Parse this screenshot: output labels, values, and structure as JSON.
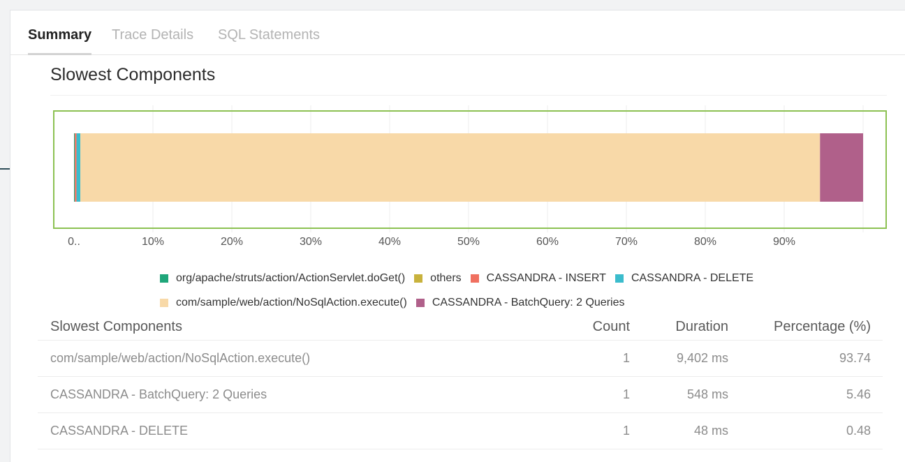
{
  "tabs": [
    {
      "label": "Summary",
      "active": true
    },
    {
      "label": "Trace Details",
      "active": false
    },
    {
      "label": "SQL Statements",
      "active": false
    }
  ],
  "section_title": "Slowest Components",
  "chart_data": {
    "type": "bar",
    "orientation": "horizontal",
    "stacked": true,
    "categories": [
      ""
    ],
    "series": [
      {
        "name": "org/apache/struts/action/ActionServlet.doGet()",
        "values": [
          0.1
        ],
        "color": "#1fa67a"
      },
      {
        "name": "others",
        "values": [
          0.0
        ],
        "color": "#c8b23d"
      },
      {
        "name": "CASSANDRA - INSERT",
        "values": [
          0.22
        ],
        "color": "#f07060"
      },
      {
        "name": "CASSANDRA - DELETE",
        "values": [
          0.48
        ],
        "color": "#3bbccc"
      },
      {
        "name": "com/sample/web/action/NoSqlAction.execute()",
        "values": [
          93.74
        ],
        "color": "#f8d9a8"
      },
      {
        "name": "CASSANDRA - BatchQuery: 2 Queries",
        "values": [
          5.46
        ],
        "color": "#b0608a"
      }
    ],
    "xlim": [
      0,
      100
    ],
    "x_ticks": [
      {
        "value": 0,
        "label": "0.."
      },
      {
        "value": 10,
        "label": "10%"
      },
      {
        "value": 20,
        "label": "20%"
      },
      {
        "value": 30,
        "label": "30%"
      },
      {
        "value": 40,
        "label": "40%"
      },
      {
        "value": 50,
        "label": "50%"
      },
      {
        "value": 60,
        "label": "60%"
      },
      {
        "value": 70,
        "label": "70%"
      },
      {
        "value": 80,
        "label": "80%"
      },
      {
        "value": 90,
        "label": "90%"
      }
    ],
    "grid": true,
    "legend_position": "bottom",
    "highlight_color": "#8cc152"
  },
  "table": {
    "headers": {
      "name": "Slowest Components",
      "count": "Count",
      "duration": "Duration",
      "percentage": "Percentage (%)"
    },
    "rows": [
      {
        "name": "com/sample/web/action/NoSqlAction.execute()",
        "count": "1",
        "duration": "9,402 ms",
        "percentage": "93.74"
      },
      {
        "name": "CASSANDRA - BatchQuery: 2 Queries",
        "count": "1",
        "duration": "548 ms",
        "percentage": "5.46"
      },
      {
        "name": "CASSANDRA - DELETE",
        "count": "1",
        "duration": "48 ms",
        "percentage": "0.48"
      }
    ]
  }
}
